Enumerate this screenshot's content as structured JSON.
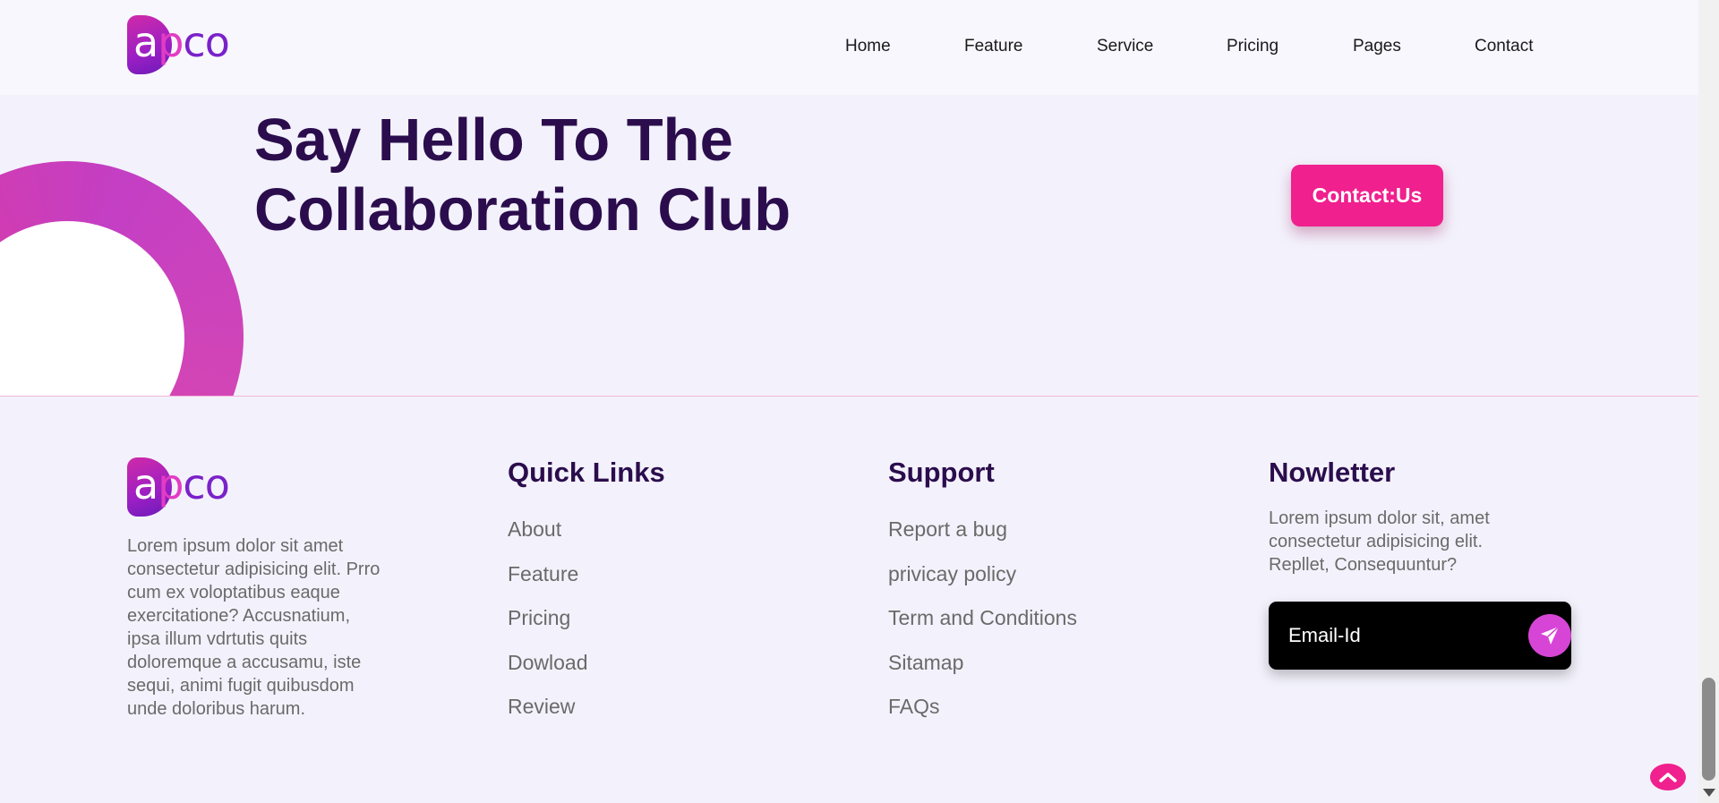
{
  "brand": {
    "logo_alt": "appco",
    "logo_parts": {
      "a": "a",
      "p": "p",
      "co": "co"
    },
    "colors": {
      "primary": "#f0208e",
      "dark": "#2b0d4d",
      "accent": "#d745d6"
    }
  },
  "nav": {
    "items": [
      {
        "label": "Home"
      },
      {
        "label": "Feature"
      },
      {
        "label": "Service"
      },
      {
        "label": "Pricing"
      },
      {
        "label": "Pages"
      },
      {
        "label": "Contact"
      }
    ]
  },
  "hero": {
    "title": "Say Hello To The Collaboration Club",
    "cta_label": "Contact:Us"
  },
  "footer": {
    "about_text": "Lorem ipsum dolor sit amet consectetur adipisicing elit. Prro cum ex voloptatibus eaque exercitatione? Accusnatium, ipsa illum vdrtutis quits doloremque a accusamu, iste sequi, animi fugit quibusdom unde doloribus harum.",
    "quick_links": {
      "heading": "Quick Links",
      "items": [
        "About",
        "Feature",
        "Pricing",
        "Dowload",
        "Review"
      ]
    },
    "support": {
      "heading": "Support",
      "items": [
        "Report a bug",
        "privicay policy",
        "Term and Conditions",
        "Sitamap",
        "FAQs"
      ]
    },
    "newsletter": {
      "heading": "Nowletter",
      "text": "Lorem ipsum dolor sit, amet consectetur adipisicing elit. Repllet, Consequuntur?",
      "input_placeholder": "Email-Id",
      "send_icon": "paper-plane-icon"
    }
  },
  "scroll_top_icon": "chevron-up-icon"
}
